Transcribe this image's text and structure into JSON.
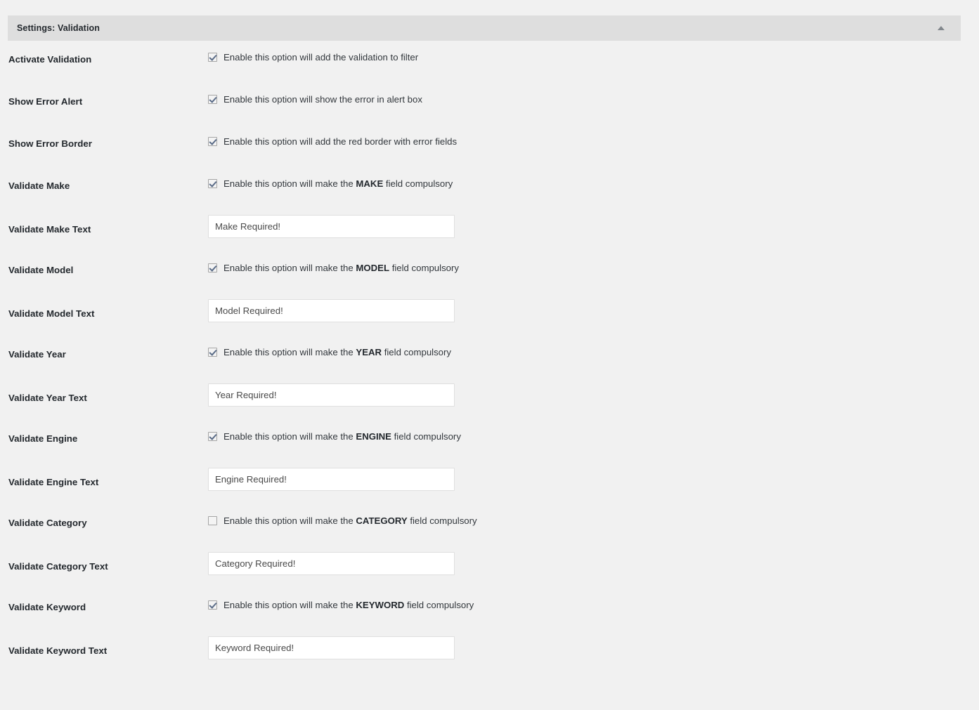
{
  "panel": {
    "title": "Settings: Validation",
    "toggle_icon": "caret-up-icon"
  },
  "rows": [
    {
      "label": "Activate Validation",
      "type": "checkbox",
      "checked": true,
      "text_before": "Enable this option will add the validation to filter",
      "text_strong": "",
      "text_after": ""
    },
    {
      "label": "Show Error Alert",
      "type": "checkbox",
      "checked": true,
      "text_before": "Enable this option will show the error in alert box",
      "text_strong": "",
      "text_after": ""
    },
    {
      "label": "Show Error Border",
      "type": "checkbox",
      "checked": true,
      "text_before": "Enable this option will add the red border with error fields",
      "text_strong": "",
      "text_after": ""
    },
    {
      "label": "Validate Make",
      "type": "checkbox",
      "checked": true,
      "text_before": "Enable this option will make the ",
      "text_strong": "MAKE",
      "text_after": " field compulsory"
    },
    {
      "label": "Validate Make Text",
      "type": "text",
      "value": "Make Required!",
      "placeholder": "Make Required!"
    },
    {
      "label": "Validate Model",
      "type": "checkbox",
      "checked": true,
      "text_before": "Enable this option will make the ",
      "text_strong": "MODEL",
      "text_after": " field compulsory"
    },
    {
      "label": "Validate Model Text",
      "type": "text",
      "value": "Model Required!",
      "placeholder": "Model Required!"
    },
    {
      "label": "Validate Year",
      "type": "checkbox",
      "checked": true,
      "text_before": "Enable this option will make the ",
      "text_strong": "YEAR",
      "text_after": " field compulsory"
    },
    {
      "label": "Validate Year Text",
      "type": "text",
      "value": "Year Required!",
      "placeholder": "Year Required!"
    },
    {
      "label": "Validate Engine",
      "type": "checkbox",
      "checked": true,
      "text_before": "Enable this option will make the ",
      "text_strong": "ENGINE",
      "text_after": " field compulsory"
    },
    {
      "label": "Validate Engine Text",
      "type": "text",
      "value": "Engine Required!",
      "placeholder": "Engine Required!"
    },
    {
      "label": "Validate Category",
      "type": "checkbox",
      "checked": false,
      "text_before": "Enable this option will make the ",
      "text_strong": "CATEGORY",
      "text_after": " field compulsory"
    },
    {
      "label": "Validate Category Text",
      "type": "text",
      "value": "Category Required!",
      "placeholder": "Category Required!"
    },
    {
      "label": "Validate Keyword",
      "type": "checkbox",
      "checked": true,
      "text_before": "Enable this option will make the ",
      "text_strong": "KEYWORD",
      "text_after": " field compulsory"
    },
    {
      "label": "Validate Keyword Text",
      "type": "text",
      "value": "Keyword Required!",
      "placeholder": "Keyword Required!"
    }
  ],
  "colors": {
    "page_background": "#f1f1f1",
    "header_background": "#dedede",
    "heading_text": "#23282d",
    "body_text": "#32373c",
    "input_border": "#dfdfdf",
    "checkbox_border": "#a5a5a5",
    "checkmark": "#5a6b87"
  }
}
